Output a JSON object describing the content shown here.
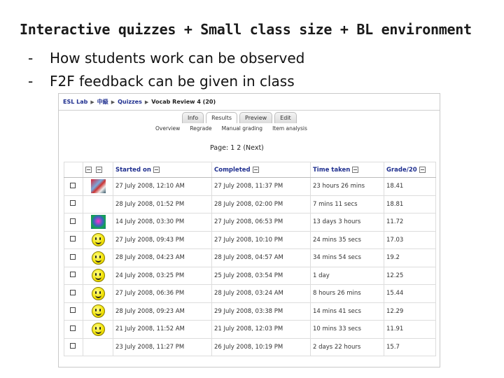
{
  "slide": {
    "title": "Interactive quizzes + Small class size + BL environment",
    "bullets": [
      {
        "marker": "-",
        "text": "How students work can be observed"
      },
      {
        "marker": "-",
        "text": "F2F feedback can be given in class"
      }
    ]
  },
  "moodle": {
    "breadcrumb": [
      {
        "label": "ESL Lab"
      },
      {
        "label": "中級"
      },
      {
        "label": "Quizzes"
      },
      {
        "label": "Vocab Review 4 (20)"
      }
    ],
    "tabs": [
      {
        "label": "Info",
        "active": false
      },
      {
        "label": "Results",
        "active": true
      },
      {
        "label": "Preview",
        "active": false
      },
      {
        "label": "Edit",
        "active": false
      }
    ],
    "subtabs": [
      "Overview",
      "Regrade",
      "Manual grading",
      "Item analysis"
    ],
    "paging": "Page: 1 2 (Next)",
    "table": {
      "columns": [
        "Started on",
        "Completed",
        "Time taken",
        "Grade/20"
      ],
      "rows": [
        {
          "avatar": "photo-a",
          "started": "27 July 2008, 12:10 AM",
          "completed": "27 July 2008, 11:37 PM",
          "time": "23 hours 26 mins",
          "grade": "18.41"
        },
        {
          "avatar": "none",
          "started": "28 July 2008, 01:52 PM",
          "completed": "28 July 2008, 02:00 PM",
          "time": "7 mins 11 secs",
          "grade": "18.81"
        },
        {
          "avatar": "photo-b",
          "started": "14 July 2008, 03:30 PM",
          "completed": "27 July 2008, 06:53 PM",
          "time": "13 days 3 hours",
          "grade": "11.72"
        },
        {
          "avatar": "smiley",
          "started": "27 July 2008, 09:43 PM",
          "completed": "27 July 2008, 10:10 PM",
          "time": "24 mins 35 secs",
          "grade": "17.03"
        },
        {
          "avatar": "smiley",
          "started": "28 July 2008, 04:23 AM",
          "completed": "28 July 2008, 04:57 AM",
          "time": "34 mins 54 secs",
          "grade": "19.2"
        },
        {
          "avatar": "smiley",
          "started": "24 July 2008, 03:25 PM",
          "completed": "25 July 2008, 03:54 PM",
          "time": "1 day",
          "grade": "12.25"
        },
        {
          "avatar": "smiley",
          "started": "27 July 2008, 06:36 PM",
          "completed": "28 July 2008, 03:24 AM",
          "time": "8 hours 26 mins",
          "grade": "15.44"
        },
        {
          "avatar": "smiley",
          "started": "28 July 2008, 09:23 AM",
          "completed": "29 July 2008, 03:38 PM",
          "time": "14 mins 41 secs",
          "grade": "12.29"
        },
        {
          "avatar": "smiley",
          "started": "21 July 2008, 11:52 AM",
          "completed": "21 July 2008, 12:03 PM",
          "time": "10 mins 33 secs",
          "grade": "11.91"
        },
        {
          "avatar": "none",
          "started": "23 July 2008, 11:27 PM",
          "completed": "26 July 2008, 10:19 PM",
          "time": "2 days 22 hours",
          "grade": "15.7"
        }
      ]
    }
  }
}
